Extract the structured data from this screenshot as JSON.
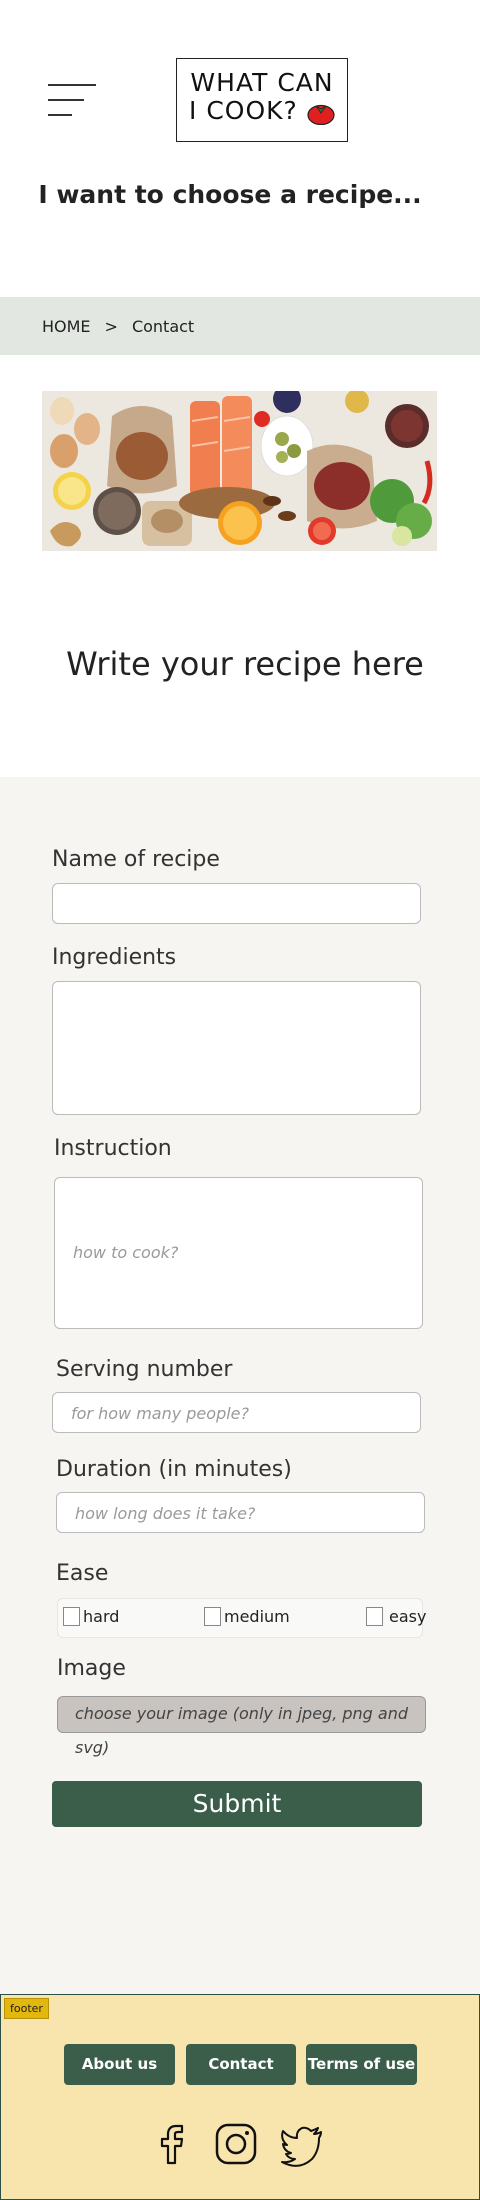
{
  "header": {
    "logo_line1": "WHAT CAN",
    "logo_line2": "I COOK?",
    "tagline": "I want to choose a recipe..."
  },
  "breadcrumb": {
    "home": "HOME",
    "separator": ">",
    "current": "Contact"
  },
  "main": {
    "title": "Write your recipe here"
  },
  "form": {
    "name_label": "Name of recipe",
    "name_value": "",
    "ingredients_label": "Ingredients",
    "ingredients_value": "",
    "instruction_label": "Instruction",
    "instruction_placeholder": "how to cook?",
    "serving_label": "Serving number",
    "serving_placeholder": "for how many people?",
    "duration_label": "Duration (in minutes)",
    "duration_placeholder": "how long does it take?",
    "ease_label": "Ease",
    "ease_options": [
      "hard",
      "medium",
      "easy"
    ],
    "image_label": "Image",
    "image_placeholder": "choose your image (only in jpeg, png and svg)",
    "submit_label": "Submit"
  },
  "footer": {
    "tag": "footer",
    "links": [
      "About us",
      "Contact",
      "Terms of use"
    ],
    "social_icons": [
      "facebook-icon",
      "instagram-icon",
      "twitter-icon"
    ]
  },
  "colors": {
    "accent_green": "#3a5e4a",
    "footer_bg": "#f7e5ad",
    "breadcrumb_bg": "#e3e7e2",
    "form_bg": "#f6f5f1",
    "tomato": "#e02020"
  }
}
